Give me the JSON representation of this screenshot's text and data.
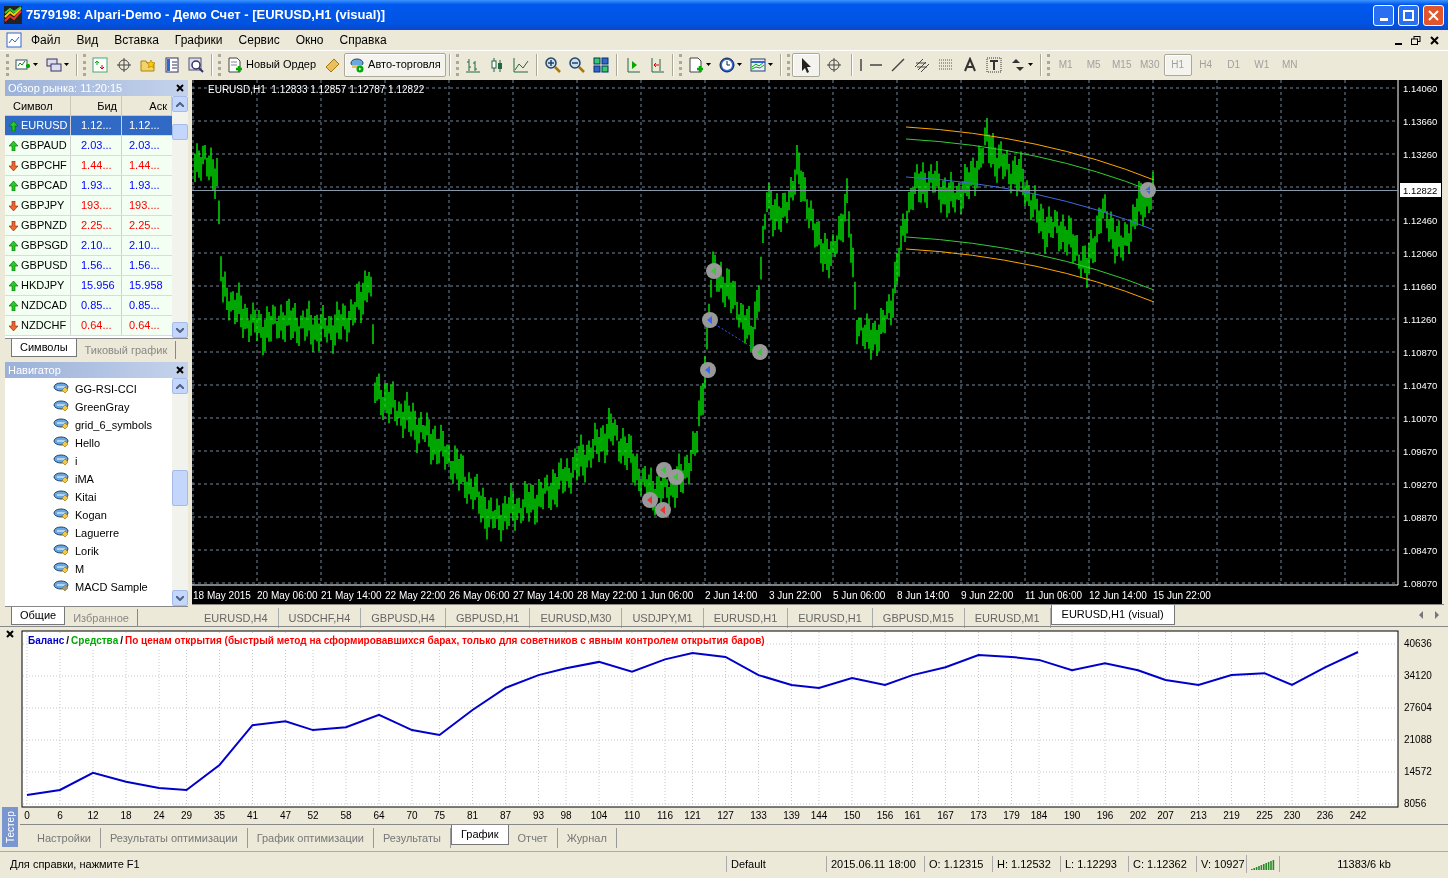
{
  "window": {
    "title": "7579198: Alpari-Demo - Демо Счет - [EURUSD,H1 (visual)]"
  },
  "menu": [
    "Файл",
    "Вид",
    "Вставка",
    "Графики",
    "Сервис",
    "Окно",
    "Справка"
  ],
  "toolbar": {
    "new_order": "Новый Ордер",
    "auto_trading": {
      "label": "Авто-торговля",
      "on": true
    },
    "pointer_tools": [
      {
        "kind": "cursor",
        "selected": true
      },
      {
        "kind": "crosshair",
        "selected": false
      }
    ],
    "timeframes": [
      {
        "label": "M1",
        "selected": false
      },
      {
        "label": "M5",
        "selected": false
      },
      {
        "label": "M15",
        "selected": false
      },
      {
        "label": "M30",
        "selected": false
      },
      {
        "label": "H1",
        "selected": true
      },
      {
        "label": "H4",
        "selected": false
      },
      {
        "label": "D1",
        "selected": false
      },
      {
        "label": "W1",
        "selected": false
      },
      {
        "label": "MN",
        "selected": false
      }
    ]
  },
  "market_watch": {
    "title": "Обзор рынка: 11:20:15",
    "columns": [
      "Символ",
      "Бид",
      "Аск"
    ],
    "rows": [
      {
        "symbol": "EURUSD",
        "bid": "1.12...",
        "ask": "1.12...",
        "rising": true,
        "selected": true
      },
      {
        "symbol": "GBPAUD",
        "bid": "2.03...",
        "ask": "2.03...",
        "rising": true,
        "selected": false
      },
      {
        "symbol": "GBPCHF",
        "bid": "1.44...",
        "ask": "1.44...",
        "rising": false,
        "selected": false
      },
      {
        "symbol": "GBPCAD",
        "bid": "1.93...",
        "ask": "1.93...",
        "rising": true,
        "selected": false
      },
      {
        "symbol": "GBPJPY",
        "bid": "193....",
        "ask": "193....",
        "rising": false,
        "selected": false
      },
      {
        "symbol": "GBPNZD",
        "bid": "2.25...",
        "ask": "2.25...",
        "rising": false,
        "selected": false
      },
      {
        "symbol": "GBPSGD",
        "bid": "2.10...",
        "ask": "2.10...",
        "rising": true,
        "selected": false
      },
      {
        "symbol": "GBPUSD",
        "bid": "1.56...",
        "ask": "1.56...",
        "rising": true,
        "selected": false
      },
      {
        "symbol": "HKDJPY",
        "bid": "15.956",
        "ask": "15.958",
        "rising": true,
        "selected": false
      },
      {
        "symbol": "NZDCAD",
        "bid": "0.85...",
        "ask": "0.85...",
        "rising": true,
        "selected": false
      },
      {
        "symbol": "NZDCHF",
        "bid": "0.64...",
        "ask": "0.64...",
        "rising": false,
        "selected": false
      }
    ],
    "tabs": [
      {
        "label": "Символы",
        "selected": true
      },
      {
        "label": "Тиковый график",
        "selected": false
      }
    ]
  },
  "navigator": {
    "title": "Навигатор",
    "items": [
      {
        "label": "GG-RSI-CCI",
        "kind": "custom"
      },
      {
        "label": "GreenGray",
        "kind": "custom"
      },
      {
        "label": "grid_6_symbols",
        "kind": "custom"
      },
      {
        "label": "Hello",
        "kind": "custom"
      },
      {
        "label": "i",
        "kind": "custom"
      },
      {
        "label": "iMA",
        "kind": "custom"
      },
      {
        "label": "Kitai",
        "kind": "custom"
      },
      {
        "label": "Kogan",
        "kind": "custom"
      },
      {
        "label": "Laguerre",
        "kind": "custom"
      },
      {
        "label": "Lorik",
        "kind": "custom"
      },
      {
        "label": "M",
        "kind": "custom"
      },
      {
        "label": "MACD Sample",
        "kind": "sample"
      }
    ],
    "tabs": [
      {
        "label": "Общие",
        "selected": true
      },
      {
        "label": "Избранное",
        "selected": false
      }
    ]
  },
  "chart": {
    "header": "EURUSD,H1  1.12833 1.12857 1.12787 1.12822",
    "price_ticks": [
      "1.14060",
      "1.13660",
      "1.13260",
      "1.12460",
      "1.12060",
      "1.11660",
      "1.11260",
      "1.10870",
      "1.10470",
      "1.10070",
      "1.09670",
      "1.09270",
      "1.08870",
      "1.08470",
      "1.08070"
    ],
    "current_price": "1.12822",
    "time_labels": [
      "18 May 2015",
      "20 May 06:00",
      "21 May 14:00",
      "22 May 22:00",
      "26 May 06:00",
      "27 May 14:00",
      "28 May 22:00",
      "1 Jun 06:00",
      "2 Jun 14:00",
      "3 Jun 22:00",
      "5 Jun 06:00",
      "8 Jun 14:00",
      "9 Jun 22:00",
      "11 Jun 06:00",
      "12 Jun 14:00",
      "15 Jun 22:00"
    ]
  },
  "chart_tabs": [
    {
      "label": "EURUSD,H4",
      "selected": false
    },
    {
      "label": "USDCHF,H4",
      "selected": false
    },
    {
      "label": "GBPUSD,H4",
      "selected": false
    },
    {
      "label": "GBPUSD,H1",
      "selected": false
    },
    {
      "label": "EURUSD,M30",
      "selected": false
    },
    {
      "label": "USDJPY,M1",
      "selected": false
    },
    {
      "label": "EURUSD,H1",
      "selected": false
    },
    {
      "label": "EURUSD,H1",
      "selected": false
    },
    {
      "label": "GBPUSD,M15",
      "selected": false
    },
    {
      "label": "EURUSD,M1",
      "selected": false
    },
    {
      "label": "EURUSD,H1 (visual)",
      "selected": true
    }
  ],
  "tester": {
    "side_label": "Тестер",
    "legend": [
      {
        "label": "Средства",
        "color": "#00aa00"
      },
      {
        "label": "По ценам открытия (быстрый метод на сформировавшихся барах, только для советников с явным контролем открытия баров)",
        "color": "#ff0000"
      }
    ],
    "legend_separator": "/",
    "chart_data": {
      "type": "line",
      "x": [
        0,
        6,
        12,
        18,
        24,
        29,
        35,
        41,
        47,
        52,
        58,
        64,
        70,
        75,
        81,
        87,
        93,
        98,
        104,
        110,
        116,
        121,
        127,
        133,
        139,
        144,
        150,
        156,
        161,
        167,
        173,
        179,
        184,
        190,
        196,
        202,
        207,
        213,
        219,
        225,
        230,
        236,
        242
      ],
      "grid": true,
      "series": [
        {
          "name": "Баланс",
          "color": "#0000cc",
          "values": [
            9900,
            10900,
            14400,
            12600,
            11300,
            10900,
            16000,
            24100,
            24900,
            23100,
            23700,
            26200,
            23100,
            22100,
            27200,
            31700,
            34300,
            35700,
            37000,
            35000,
            37500,
            38800,
            38000,
            34300,
            32300,
            31700,
            33700,
            32300,
            34300,
            35900,
            38400,
            38000,
            37400,
            35300,
            36700,
            35300,
            33300,
            32300,
            34300,
            34700,
            32300,
            35900,
            39000
          ]
        }
      ],
      "xlim": [
        0,
        242
      ],
      "ylim": [
        8056,
        40636
      ],
      "yticks": [
        40636,
        34120,
        27604,
        21088,
        14572,
        8056
      ],
      "xticks": [
        0,
        6,
        12,
        18,
        24,
        29,
        35,
        41,
        47,
        52,
        58,
        64,
        70,
        75,
        81,
        87,
        93,
        98,
        104,
        110,
        116,
        121,
        127,
        133,
        139,
        144,
        150,
        156,
        161,
        167,
        173,
        179,
        184,
        190,
        196,
        202,
        207,
        213,
        219,
        225,
        230,
        236,
        242
      ]
    },
    "tabs": [
      {
        "label": "Настройки",
        "selected": false
      },
      {
        "label": "Результаты оптимизации",
        "selected": false
      },
      {
        "label": "График оптимизации",
        "selected": false
      },
      {
        "label": "Результаты",
        "selected": false
      },
      {
        "label": "График",
        "selected": true
      },
      {
        "label": "Отчет",
        "selected": false
      },
      {
        "label": "Журнал",
        "selected": false
      }
    ]
  },
  "status_bar": [
    "Для справки, нажмите F1",
    "Default",
    "2015.06.11 18:00",
    "O: 1.12315",
    "H: 1.12532",
    "L: 1.12293",
    "C: 1.12362",
    "V: 10927",
    "11383/6 kb"
  ]
}
